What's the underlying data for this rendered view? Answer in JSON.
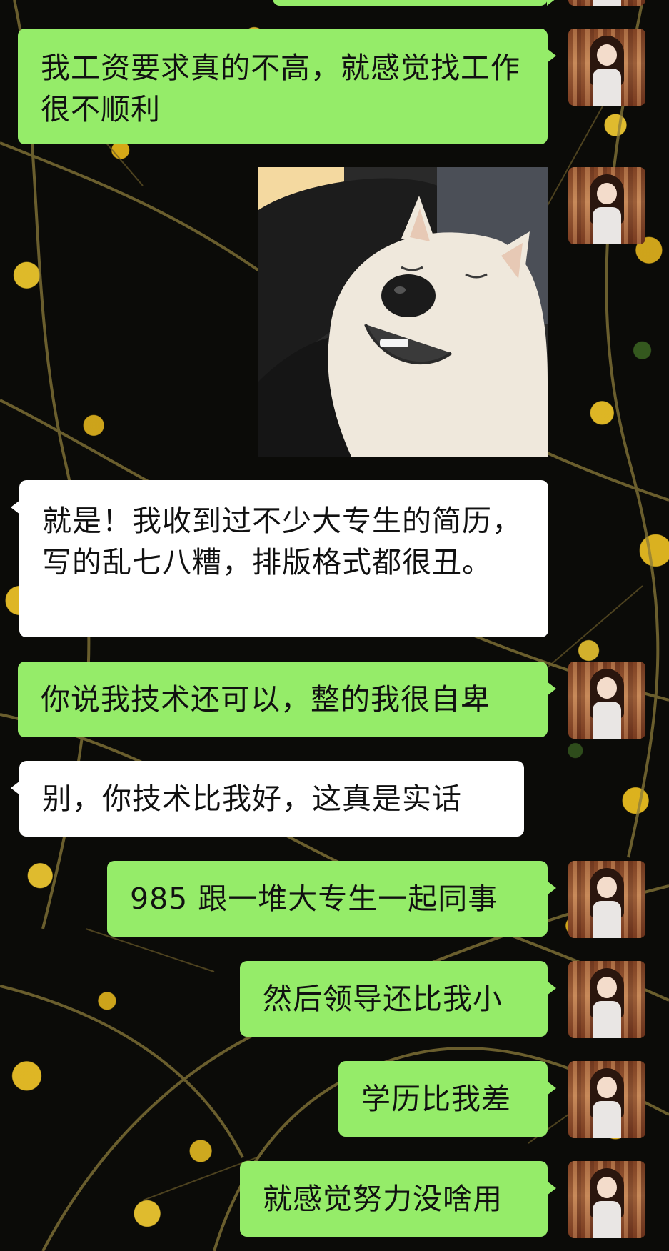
{
  "chat": {
    "messages": [
      {
        "side": "right",
        "text": "我工资要求真的不高，就感觉找工作很不顺利"
      },
      {
        "side": "right",
        "type": "sticker",
        "sticker": "dog-squished-face-sticker"
      },
      {
        "side": "left",
        "text": "就是！我收到过不少大专生的简历，写的乱七八糟，排版格式都很丑。"
      },
      {
        "side": "right",
        "text": "你说我技术还可以，整的我很自卑"
      },
      {
        "side": "left",
        "text": "别，你技术比我好，这真是实话"
      },
      {
        "side": "right",
        "text": "985 跟一堆大专生一起同事"
      },
      {
        "side": "right",
        "text": "然后领导还比我小"
      },
      {
        "side": "right",
        "text": "学历比我差"
      },
      {
        "side": "right",
        "text": "就感觉努力没啥用"
      }
    ]
  },
  "colors": {
    "bubble_self": "#95ec69",
    "bubble_other": "#ffffff",
    "background": "#0b0b08",
    "flower": "#f2c420"
  },
  "icons": {
    "avatar": "user-avatar-anime-girl"
  }
}
